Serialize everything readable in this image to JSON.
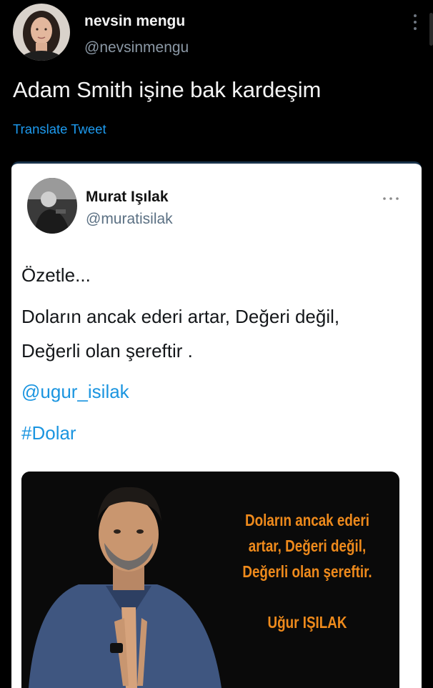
{
  "tweet": {
    "author_name": "nevsin mengu",
    "author_handle": "@nevsinmengu",
    "text": "Adam Smith işine bak kardeşim",
    "translate_label": "Translate Tweet",
    "more_icon": "vertical-ellipsis-icon"
  },
  "quoted_tweet": {
    "author_name": "Murat Işılak",
    "author_handle": "@muratisilak",
    "more_icon": "horizontal-ellipsis-icon",
    "lines": [
      "Özetle...",
      "Doların ancak ederi artar, Değeri değil,",
      "Değerli olan şereftir ."
    ],
    "mention": "@ugur_isilak",
    "hashtag": "#Dolar",
    "image": {
      "quote_lines": [
        "Doların ancak ederi",
        "artar, Değeri değil,",
        "Değerli olan şereftir."
      ],
      "quote_author": "Uğur IŞILAK",
      "quote_color": "#ee8a1c"
    }
  },
  "colors": {
    "background": "#000000",
    "link": "#1d9bf0",
    "card_background": "#ffffff"
  }
}
